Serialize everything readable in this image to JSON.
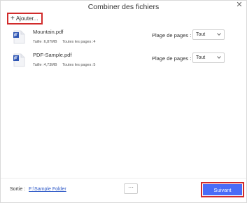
{
  "dialog": {
    "title": "Combiner des fichiers"
  },
  "toolbar": {
    "add_label": "Ajouter..."
  },
  "files": [
    {
      "name": "Mountain.pdf",
      "size": "Taille :6,87MB",
      "pages": "Toutes les pages :4",
      "page_range_label": "Plage de pages :",
      "page_range_value": "Tout"
    },
    {
      "name": "PDF-Sample.pdf",
      "size": "Taille :4,73MB",
      "pages": "Toutes les pages :5",
      "page_range_label": "Plage de pages :",
      "page_range_value": "Tout"
    }
  ],
  "footer": {
    "output_label": "Sortie :",
    "output_path": "F:\\Sample Folder",
    "more_label": "···",
    "next_label": "Suivant"
  },
  "colors": {
    "accent": "#4a6cf7",
    "highlight": "#d12b2b",
    "pdf_icon": "#2f56b3"
  },
  "icons": {
    "close": "close-icon",
    "add": "plus-icon",
    "file": "pdf-file-icon",
    "dropdown": "chevron-down-icon"
  }
}
